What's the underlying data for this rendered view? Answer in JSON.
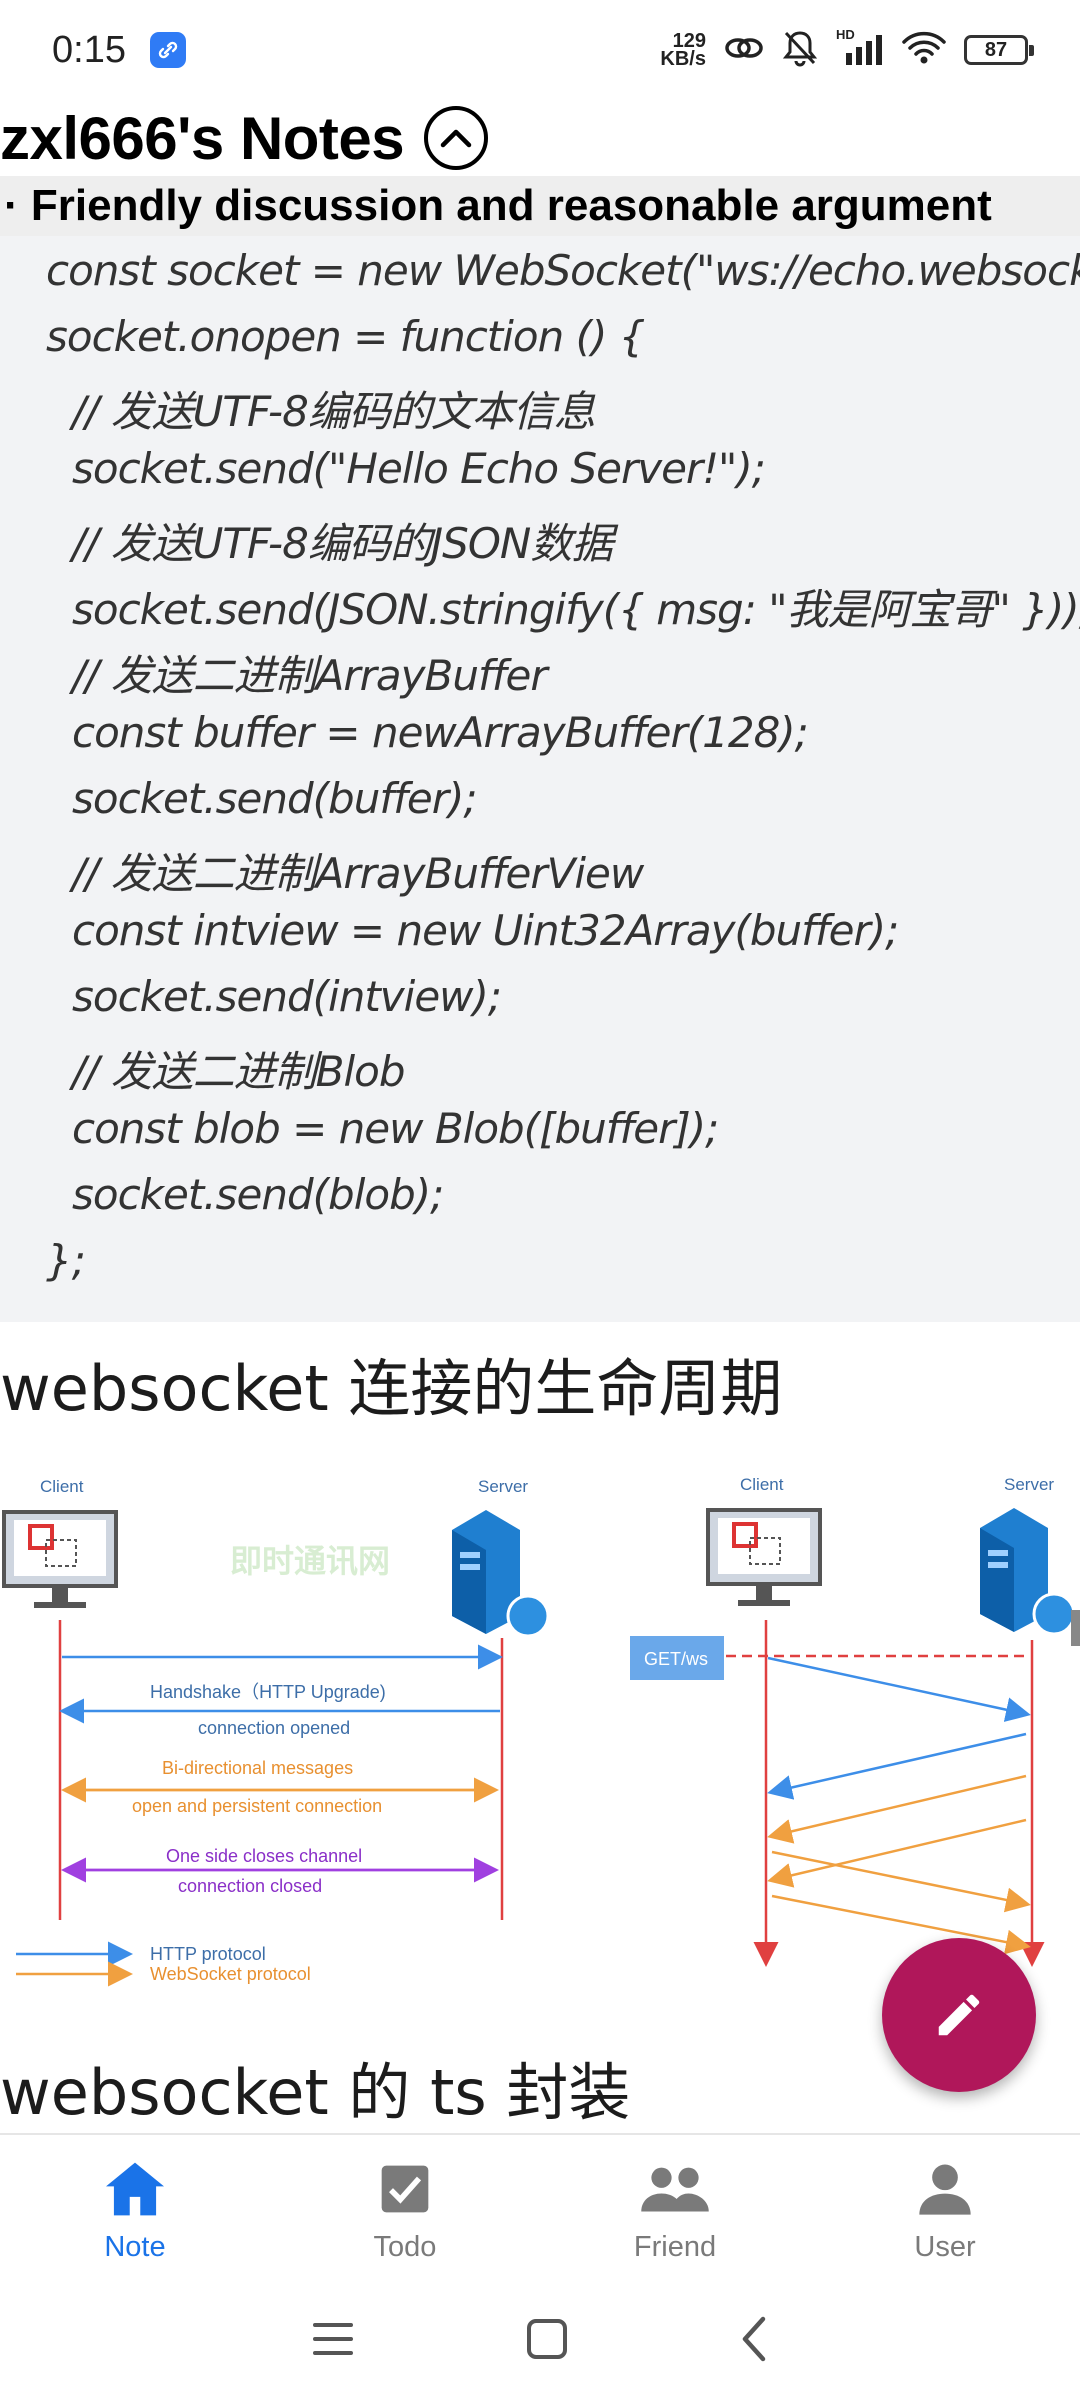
{
  "status_bar": {
    "time": "0:15",
    "net_speed_value": "129",
    "net_speed_unit": "KB/s",
    "signal_label": "HD",
    "battery": "87"
  },
  "header": {
    "title": "zxl666's Notes",
    "subtitle": "· Friendly discussion and reasonable argument"
  },
  "code_lines": [
    "const socket = new WebSocket(\"ws://echo.websocket.org\");",
    "socket.onopen = function () {",
    "  // 发送UTF-8编码的文本信息",
    "  socket.send(\"Hello Echo Server!\");",
    "  // 发送UTF-8编码的JSON数据",
    "  socket.send(JSON.stringify({ msg: \"我是阿宝哥\" }));",
    "  // 发送二进制ArrayBuffer",
    "  const buffer = newArrayBuffer(128);",
    "  socket.send(buffer);",
    "  // 发送二进制ArrayBufferView",
    "  const intview = new Uint32Array(buffer);",
    "  socket.send(intview);",
    "  // 发送二进制Blob",
    "  const blob = new Blob([buffer]);",
    "  socket.send(blob);",
    "};"
  ],
  "sections": {
    "lifecycle_heading": "websocket 连接的生命周期",
    "ts_heading": "websocket 的 ts 封装"
  },
  "diagram": {
    "client_label": "Client",
    "server_label": "Server",
    "watermark": "即时通讯网",
    "handshake": "Handshake（HTTP Upgrade)",
    "opened": "connection opened",
    "bidirectional": "Bi-directional messages",
    "persistent": "open and persistent connection",
    "closes": "One side closes channel",
    "closed": "connection closed",
    "legend_http": "HTTP protocol",
    "legend_ws": "WebSocket protocol",
    "get_ws": "GET/ws",
    "colors": {
      "http": "#3d8ee8",
      "ws": "#f0a040",
      "close": "#a040e0",
      "lifeline": "#e04040"
    }
  },
  "nav": {
    "items": [
      {
        "label": "Note",
        "icon": "home-icon",
        "active": true
      },
      {
        "label": "Todo",
        "icon": "checkbox-icon",
        "active": false
      },
      {
        "label": "Friend",
        "icon": "people-icon",
        "active": false
      },
      {
        "label": "User",
        "icon": "person-icon",
        "active": false
      }
    ]
  },
  "colors": {
    "accent": "#1a73e8",
    "fab": "#b0175a"
  }
}
